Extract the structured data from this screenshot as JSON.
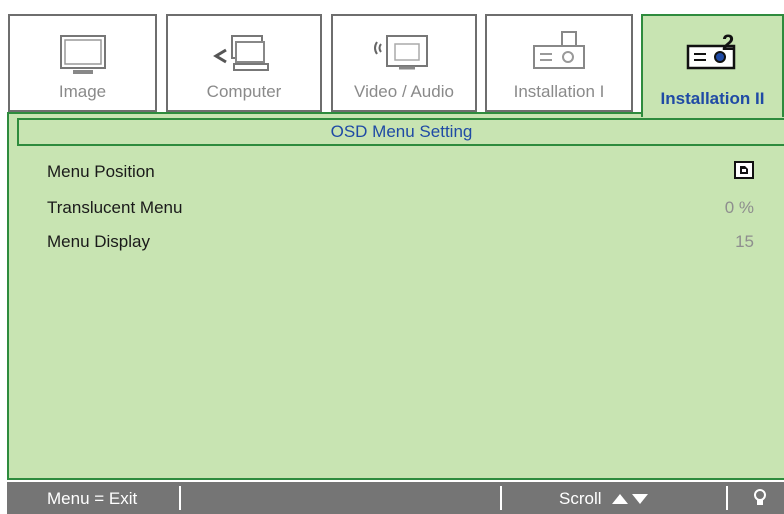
{
  "tabs": [
    {
      "label": "Image",
      "icon": "monitor-icon"
    },
    {
      "label": "Computer",
      "icon": "computer-icon"
    },
    {
      "label": "Video / Audio",
      "icon": "video-audio-icon"
    },
    {
      "label": "Installation I",
      "icon": "projector-icon"
    },
    {
      "label": "Installation II",
      "icon": "projector-settings-icon",
      "active": true
    }
  ],
  "panel": {
    "title": "OSD Menu Setting",
    "items": [
      {
        "label": "Menu Position",
        "value": ""
      },
      {
        "label": "Translucent Menu",
        "value": "0 %"
      },
      {
        "label": "Menu Display",
        "value": "15"
      }
    ]
  },
  "footer": {
    "exit": "Menu = Exit",
    "scroll": "Scroll"
  },
  "colors": {
    "panel_bg": "#c8e4b2",
    "panel_border": "#2e8b3d",
    "accent_text": "#1f4aa5",
    "footer_bg": "#757575"
  }
}
